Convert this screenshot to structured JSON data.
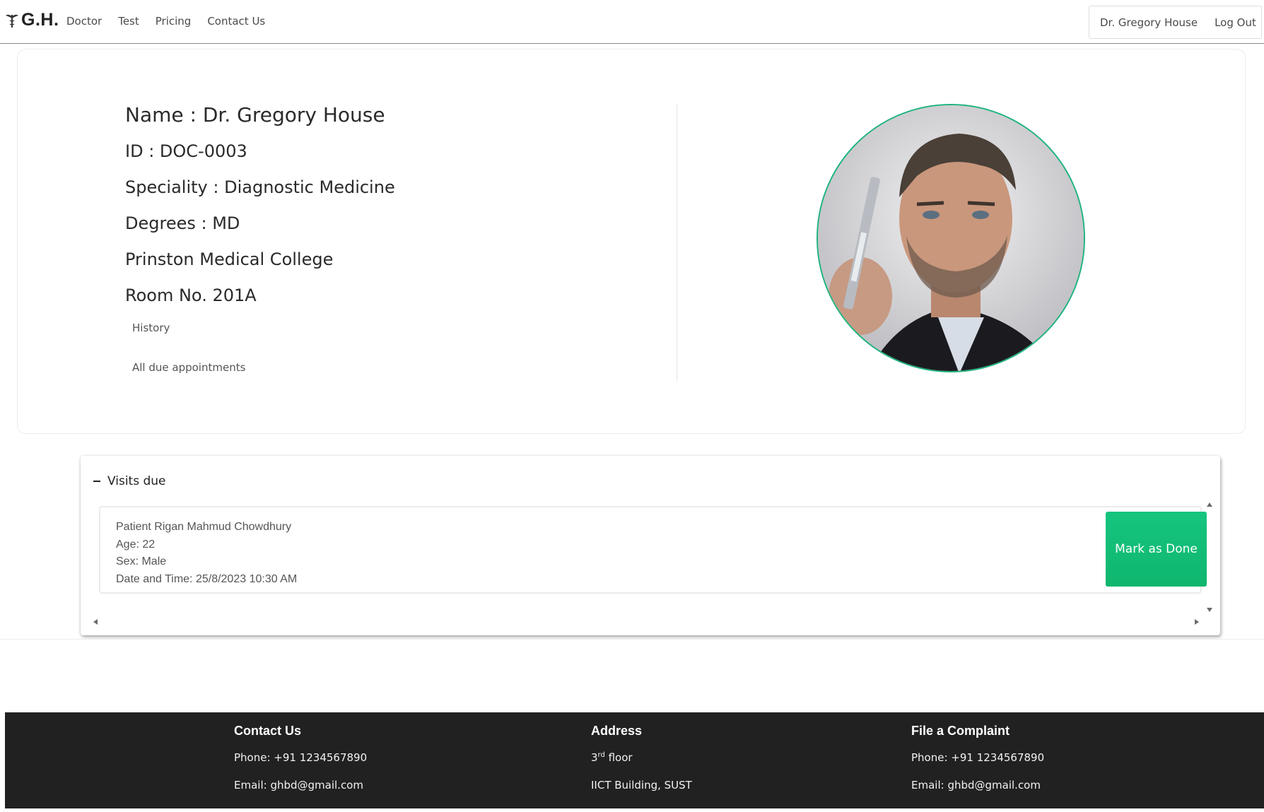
{
  "navbar": {
    "brand": "G.H.",
    "links": [
      "Doctor",
      "Test",
      "Pricing",
      "Contact Us"
    ],
    "user_name": "Dr. Gregory House",
    "logout": "Log Out"
  },
  "profile": {
    "name": "Name : Dr. Gregory House",
    "id": "ID : DOC-0003",
    "speciality": "Speciality : Diagnostic Medicine",
    "degrees": "Degrees : MD",
    "college": "Prinston Medical College",
    "room": "Room No. 201A",
    "history_link": "History",
    "due_link": "All due appointments"
  },
  "visits": {
    "title": "Visits due",
    "appointments": [
      {
        "patient": "Patient Rigan Mahmud Chowdhury",
        "age": "Age: 22",
        "sex": "Sex: Male",
        "datetime": "Date and Time: 25/8/2023 10:30 AM",
        "action": "Mark as Done"
      }
    ]
  },
  "footer": {
    "contact": {
      "title": "Contact Us",
      "phone": "Phone: +91 1234567890",
      "email": "Email: ghbd@gmail.com"
    },
    "address": {
      "title": "Address",
      "floor_num": "3",
      "floor_sup": "rd",
      "floor_text": " floor",
      "building": "IICT Building, SUST"
    },
    "complaint": {
      "title": "File a Complaint",
      "phone": "Phone: +91 1234567890",
      "email": "Email: ghbd@gmail.com"
    }
  },
  "colors": {
    "accent": "#16c57f",
    "footer_bg": "#212121"
  },
  "icons": [
    "caduceus-icon",
    "collapse-minus-icon",
    "scroll-up-icon",
    "scroll-down-icon",
    "scroll-left-icon",
    "scroll-right-icon"
  ]
}
